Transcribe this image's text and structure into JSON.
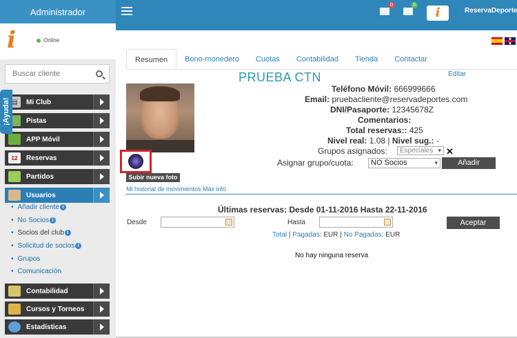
{
  "app": {
    "title": "Administrador",
    "site_name": "ReservaDeportes",
    "logo_letter": "i"
  },
  "notifications": {
    "messages_count": "0",
    "tasks_count": "0"
  },
  "sidebar": {
    "status": "Online",
    "search_placeholder": "Buscar cliente",
    "help_tab": "¡Ayuda!",
    "menu": [
      {
        "label": "Mi Club",
        "icon": "club-icon"
      },
      {
        "label": "Pistas",
        "icon": "court-icon"
      },
      {
        "label": "APP Móvil",
        "icon": "mobile-icon"
      },
      {
        "label": "Reservas",
        "icon": "calendar-icon"
      },
      {
        "label": "Partidos",
        "icon": "matches-icon"
      },
      {
        "label": "Usuarios",
        "icon": "users-icon",
        "active": true
      },
      {
        "label": "Contabilidad",
        "icon": "accounting-icon"
      },
      {
        "label": "Cursos y Torneos",
        "icon": "trophy-icon"
      },
      {
        "label": "Estadísticas",
        "icon": "stats-icon"
      }
    ],
    "submenu": [
      {
        "label": "Añadir cliente",
        "info": true
      },
      {
        "label": "No Socios",
        "info": true
      },
      {
        "label": "Socios del club",
        "info": true
      },
      {
        "label": "Solicitud de socios",
        "info": true
      },
      {
        "label": "Grupos",
        "info": false
      },
      {
        "label": "Comunicación",
        "info": false
      }
    ]
  },
  "tabs": [
    "Resumen",
    "Bono-monedero",
    "Cuotas",
    "Contabilidad",
    "Tienda",
    "Contactar"
  ],
  "client": {
    "name": "PRUEBA CTN",
    "edit_label": "Editar",
    "upload_photo_label": "Subir nueva foto",
    "phone_label": "Teléfono Móvil:",
    "phone": "666999666",
    "email_label": "Email:",
    "email": "pruebacliente@reservadeportes.com",
    "dni_label": "DNI/Pasaporte:",
    "dni": "12345678Z",
    "comments_label": "Comentarios:",
    "comments": "",
    "total_label": "Total reservas::",
    "total": "425",
    "level_label": "Nivel real:",
    "level": "1.08",
    "level_sug_label": "Nivel sug.:",
    "level_sug": "-",
    "groups_label": "Grupos asignados:",
    "groups_value": "Especiales",
    "assign_label": "Asignar grupo/cuota:",
    "assign_value": "NO Socios",
    "add_button": "Añadir",
    "history_link": "Mi historial de movimientos Más info"
  },
  "reservations": {
    "title": "Últimas reservas: Desde 01-11-2016 Hasta 22-11-2016",
    "from_label": "Desde",
    "to_label": "Hasta",
    "accept_button": "Aceptar",
    "total_link": "Total",
    "separator": " | ",
    "paid_link": "Pagadas",
    "paid_unit": ": EUR",
    "unpaid_link": "No Pagadas",
    "unpaid_unit": ": EUR",
    "empty_message": "No hay ninguna reserva"
  },
  "colors": {
    "primary": "#2e86b9",
    "accent": "#f07c1a",
    "dark_button": "#4d4d4d",
    "highlight": "#d0262a"
  }
}
